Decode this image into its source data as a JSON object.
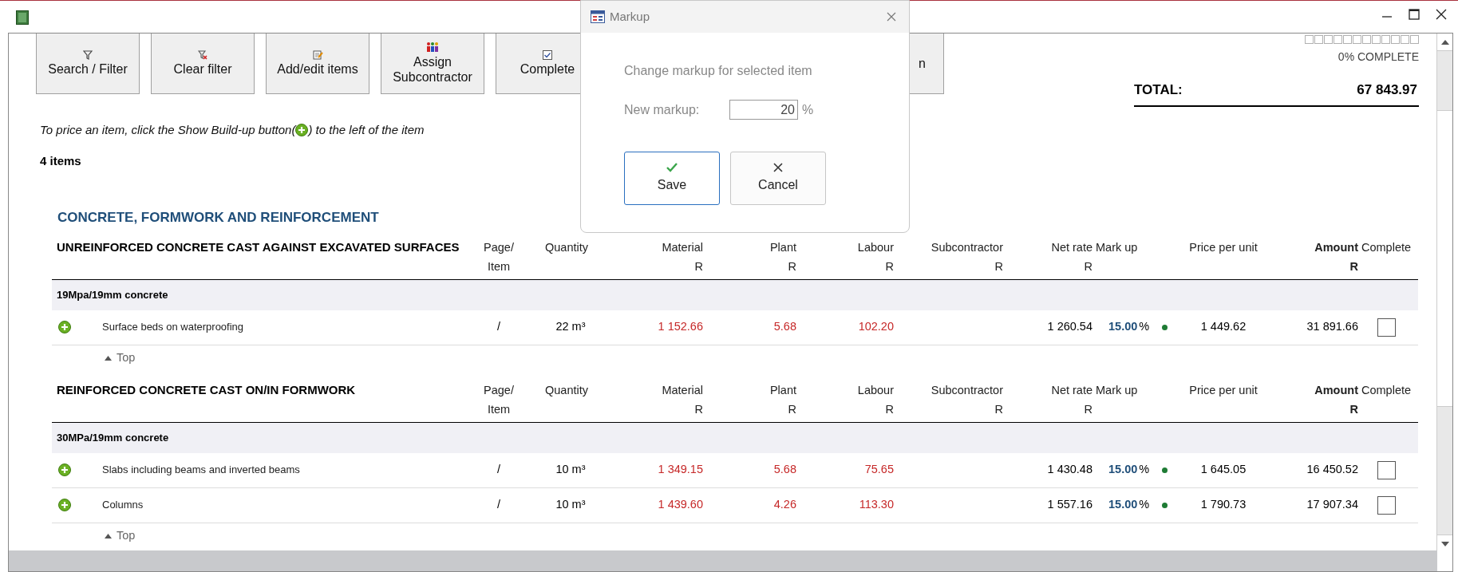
{
  "toolbar": [
    {
      "label": "Search / Filter",
      "kind": "filter"
    },
    {
      "label": "Clear filter",
      "kind": "clear-filter"
    },
    {
      "label": "Add/edit items",
      "kind": "edit"
    },
    {
      "label": "Assign Subcontractor",
      "kind": "people"
    },
    {
      "label": "Complete",
      "kind": "check"
    },
    {
      "label": "n",
      "kind": "plain"
    }
  ],
  "progress": {
    "label": "0% COMPLETE"
  },
  "total": {
    "label": "TOTAL:",
    "value": "67 843.97"
  },
  "hint_before": "To price an item, click the Show Build-up button(",
  "hint_after": ") to the left of the item",
  "item_count": "4 items",
  "category": "CONCRETE, FORMWORK AND REINFORCEMENT",
  "sections": [
    {
      "title": "UNREINFORCED CONCRETE CAST AGAINST EXCAVATED SURFACES",
      "columns": [
        {
          "label": "Page/",
          "unit": "Item"
        },
        {
          "label": "Quantity"
        },
        {
          "label": "Material",
          "unit": "R"
        },
        {
          "label": "Plant",
          "unit": "R"
        },
        {
          "label": "Labour",
          "unit": "R"
        },
        {
          "label": "Subcontractor",
          "unit": "R"
        },
        {
          "label": "Net rate",
          "unit": "R"
        },
        {
          "label": "Mark up"
        },
        {
          "label": "Price per unit"
        },
        {
          "label": "Amount",
          "unit": "R",
          "bold": true
        },
        {
          "label": "Complete"
        }
      ],
      "groups": [
        {
          "title": "19Mpa/19mm concrete",
          "items": [
            {
              "description": "Surface beds on waterproofing",
              "page": "/",
              "quantity": "22 m³",
              "material": "1 152.66",
              "plant": "5.68",
              "labour": "102.20",
              "net_rate": "1 260.54",
              "markup": "15.00",
              "markup_unit": "%",
              "color": "#1e7b34",
              "price": "1 449.62",
              "amount": "31 891.66",
              "complete": false
            }
          ]
        }
      ],
      "top_link": "Top"
    },
    {
      "title": "REINFORCED CONCRETE CAST ON/IN FORMWORK",
      "columns": [
        {
          "label": "Page/",
          "unit": "Item"
        },
        {
          "label": "Quantity"
        },
        {
          "label": "Material",
          "unit": "R"
        },
        {
          "label": "Plant",
          "unit": "R"
        },
        {
          "label": "Labour",
          "unit": "R"
        },
        {
          "label": "Subcontractor",
          "unit": "R"
        },
        {
          "label": "Net rate",
          "unit": "R"
        },
        {
          "label": "Mark up"
        },
        {
          "label": "Price per unit"
        },
        {
          "label": "Amount",
          "unit": "R",
          "bold": true
        },
        {
          "label": "Complete"
        }
      ],
      "groups": [
        {
          "title": "30MPa/19mm concrete",
          "items": [
            {
              "description": "Slabs including beams and inverted beams",
              "page": "/",
              "quantity": "10 m³",
              "material": "1 349.15",
              "plant": "5.68",
              "labour": "75.65",
              "net_rate": "1 430.48",
              "markup": "15.00",
              "markup_unit": "%",
              "color": "#1e7b34",
              "price": "1 645.05",
              "amount": "16 450.52",
              "complete": false
            },
            {
              "description": "Columns",
              "page": "/",
              "quantity": "10 m³",
              "material": "1 439.60",
              "plant": "4.26",
              "labour": "113.30",
              "net_rate": "1 557.16",
              "markup": "15.00",
              "markup_unit": "%",
              "color": "#1e7b34",
              "price": "1 790.73",
              "amount": "17 907.34",
              "complete": false
            }
          ]
        }
      ],
      "top_link": "Top"
    }
  ],
  "dialog": {
    "title": "Markup",
    "prompt": "Change markup for selected item",
    "field_label": "New markup:",
    "value": "20",
    "unit": "%",
    "buttons": [
      {
        "label": "Save",
        "kind": "save",
        "focused": true
      },
      {
        "label": "Cancel",
        "kind": "cancel",
        "focused": false
      }
    ]
  }
}
